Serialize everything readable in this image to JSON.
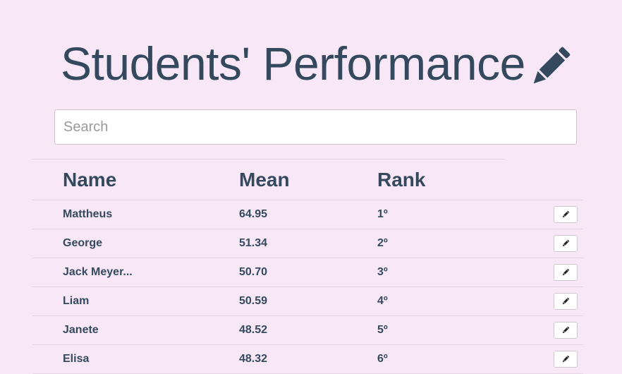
{
  "page": {
    "title": "Students' Performance",
    "title_icon": "pencil-icon"
  },
  "search": {
    "placeholder": "Search",
    "value": ""
  },
  "table": {
    "headers": {
      "name": "Name",
      "mean": "Mean",
      "rank": "Rank"
    },
    "rows": [
      {
        "name": "Mattheus",
        "mean": "64.95",
        "rank": "1º",
        "action_icon": "pencil-icon"
      },
      {
        "name": "George",
        "mean": "51.34",
        "rank": "2º",
        "action_icon": "pencil-icon"
      },
      {
        "name": "Jack Meyer...",
        "mean": "50.70",
        "rank": "3º",
        "action_icon": "pencil-icon"
      },
      {
        "name": "Liam",
        "mean": "50.59",
        "rank": "4º",
        "action_icon": "pencil-icon"
      },
      {
        "name": "Janete",
        "mean": "48.52",
        "rank": "5º",
        "action_icon": "pencil-icon"
      },
      {
        "name": "Elisa",
        "mean": "48.32",
        "rank": "6º",
        "action_icon": "pencil-icon"
      }
    ]
  },
  "colors": {
    "background": "#f8e8f7",
    "text": "#34495e",
    "divider": "#e4d3e3"
  }
}
